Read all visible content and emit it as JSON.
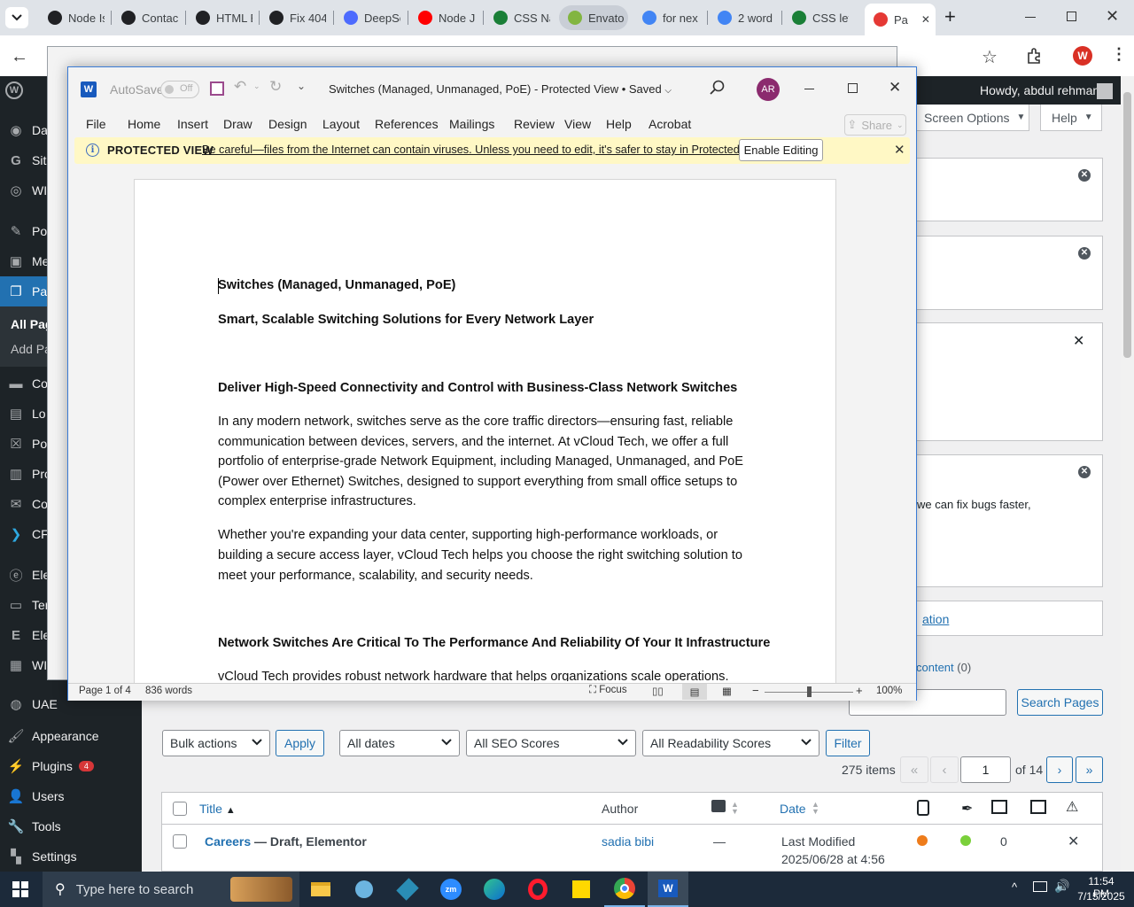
{
  "browser": {
    "tabs": [
      {
        "label": "Node Is",
        "color": "#202124",
        "icon": "chatgpt-icon"
      },
      {
        "label": "Contac",
        "color": "#202124",
        "icon": "chatgpt-icon"
      },
      {
        "label": "HTML Ele",
        "color": "#202124",
        "icon": "chatgpt-icon"
      },
      {
        "label": "Fix 404",
        "color": "#202124",
        "icon": "chatgpt-icon"
      },
      {
        "label": "DeepSe",
        "color": "#4d6bfe",
        "icon": "deepseek-icon"
      },
      {
        "label": "Node J",
        "color": "#ff0000",
        "icon": "youtube-icon"
      },
      {
        "label": "CSS Na",
        "color": "#1a7f37",
        "icon": "w3schools-icon"
      },
      {
        "label": "Envato",
        "color": "#82b541",
        "icon": "envato-icon"
      },
      {
        "label": "for nex",
        "color": "#4285f4",
        "icon": "google-icon"
      },
      {
        "label": "2 word",
        "color": "#4285f4",
        "icon": "google-icon"
      },
      {
        "label": "CSS let",
        "color": "#1a7f37",
        "icon": "w3schools-icon"
      },
      {
        "label": "Pa",
        "color": "#e53935",
        "icon": "wp-pages-icon"
      }
    ]
  },
  "wp": {
    "greeting": "Howdy, abdul rehman",
    "screen_options": "Screen Options",
    "help": "Help",
    "menu_partial": [
      "Da",
      "Sit",
      "WI",
      "Po",
      "Me",
      "Pa",
      "All Pag",
      "Add Pa",
      "Co",
      "Lo",
      "Po",
      "Pro",
      "Co",
      "CF",
      "Ele",
      "Ter",
      "Ele",
      "WI"
    ],
    "menu": [
      "UAE",
      "Appearance",
      "Plugins",
      "Users",
      "Tools",
      "Settings"
    ],
    "plugins_badge": "4",
    "notice_partial": "we can fix bugs faster,",
    "link_partial": "ation",
    "content_filter": "content",
    "content_count": "(0)",
    "search_button": "Search Pages",
    "filters": {
      "bulk": "Bulk actions",
      "apply": "Apply",
      "dates": "All dates",
      "seo": "All SEO Scores",
      "readability": "All Readability Scores",
      "filter": "Filter"
    },
    "pagination": {
      "items": "275 items",
      "current": "1",
      "of": "of 14",
      "first": "«",
      "prev": "‹",
      "next": "›",
      "last": "»"
    },
    "table": {
      "title": "Title",
      "author": "Author",
      "date": "Date"
    },
    "row": {
      "title": "Careers",
      "state": " — Draft, Elementor",
      "author": "sadia bibi",
      "comments": "—",
      "date1": "Last Modified",
      "date2": "2025/06/28 at 4:56",
      "count": "0"
    }
  },
  "word": {
    "autosave": "AutoSave",
    "autosave_state": "Off",
    "title": "Switches (Managed, Unmanaged, PoE)  -  Protected View  •  Saved",
    "avatar": "AR",
    "ribbon": [
      "File",
      "Home",
      "Insert",
      "Draw",
      "Design",
      "Layout",
      "References",
      "Mailings",
      "Review",
      "View",
      "Help",
      "Acrobat"
    ],
    "share": "Share",
    "pv_label": "PROTECTED VIEW",
    "pv_message": "Be careful—files from the Internet can contain viruses. Unless you need to edit, it's safer to stay in Protected View.",
    "enable_editing": "Enable Editing",
    "doc": {
      "title": "Switches (Managed, Unmanaged, PoE)",
      "subtitle": "Smart, Scalable Switching Solutions for Every Network Layer",
      "h1": "Deliver High-Speed Connectivity and Control with Business-Class Network Switches",
      "p1": [
        "In any modern network, switches serve as the core traffic directors—ensuring fast, reliable",
        "communication between devices, servers, and the internet. At vCloud Tech, we offer a full",
        "portfolio of enterprise-grade Network Equipment, including Managed, Unmanaged, and PoE",
        "(Power over Ethernet) Switches, designed to support everything from small office setups to",
        "complex enterprise infrastructures."
      ],
      "p2": [
        "Whether you're expanding your data center, supporting high-performance workloads, or",
        "building a secure access layer, vCloud Tech helps you choose the right switching solution to",
        "meet your performance, scalability, and security needs."
      ],
      "h2": "Network Switches Are Critical To The Performance And Reliability Of Your It Infrastructure",
      "p3": "vCloud Tech provides robust network hardware that helps organizations scale operations."
    },
    "status": {
      "page": "Page 1 of 4",
      "words": "836 words",
      "focus": "Focus",
      "zoom": "100%",
      "zoom_level": 1.0
    }
  },
  "taskbar": {
    "search": "Type here to search",
    "time": "11:54 PM",
    "date": "7/15/2025"
  }
}
